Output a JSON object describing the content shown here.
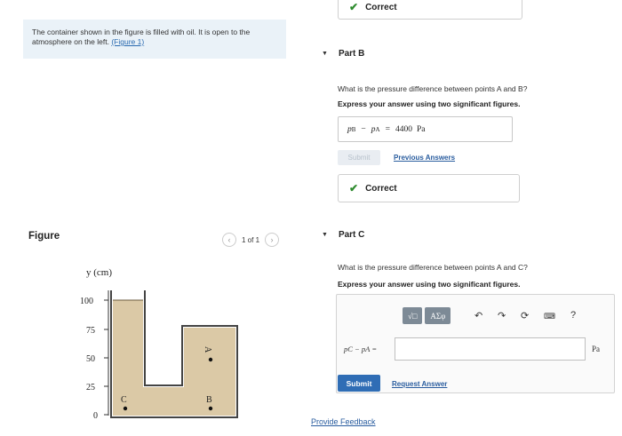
{
  "intro": {
    "text": "The container shown in the figure is filled with oil. It is open to the atmosphere on the left.",
    "figure_link": "(Figure 1)"
  },
  "figure_panel": {
    "label": "Figure",
    "pager": "1 of 1",
    "axis_label": "y (cm)",
    "ticks": [
      "100",
      "75",
      "50",
      "25",
      "0"
    ],
    "points": {
      "a": "A",
      "b": "B",
      "c": "C"
    }
  },
  "top_correct": {
    "label": "Correct"
  },
  "part_b": {
    "title": "Part B",
    "question": "What is the pressure difference between points A and B?",
    "instruction": "Express your answer using two significant figures.",
    "answer": {
      "pb": "p",
      "pb_sub": "B",
      "minus": "−",
      "pa": "p",
      "pa_sub": "A",
      "equals": "=",
      "value": "4400",
      "unit": "Pa"
    },
    "submit_label": "Submit",
    "previous_answers": "Previous Answers",
    "correct_label": "Correct"
  },
  "part_c": {
    "title": "Part C",
    "question": "What is the pressure difference between points A and C?",
    "instruction": "Express your answer using two significant figures.",
    "toolbar": {
      "templates": "√□",
      "greek": "ΑΣφ",
      "help": "?"
    },
    "equation_label": "pC − pA =",
    "input_value": "",
    "unit": "Pa",
    "submit_label": "Submit",
    "request_answer": "Request Answer"
  },
  "footer": {
    "provide_feedback": "Provide Feedback"
  },
  "colors": {
    "oil": "#dbc9a6",
    "link": "#2a5d9f",
    "submit": "#2f6db5",
    "correct": "#2e8b2e",
    "intro_bg": "#eaf2f8"
  }
}
